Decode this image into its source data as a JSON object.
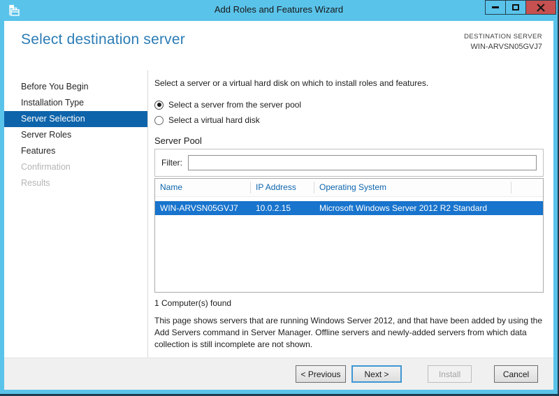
{
  "window": {
    "title": "Add Roles and Features Wizard",
    "icon": "wizard-toolbox-icon",
    "controls": [
      {
        "name": "minimize",
        "icon": "minimize-icon"
      },
      {
        "name": "maximize",
        "icon": "maximize-icon"
      },
      {
        "name": "close",
        "icon": "close-icon"
      }
    ]
  },
  "header": {
    "title": "Select destination server",
    "destination_label": "DESTINATION SERVER",
    "destination_server": "WIN-ARVSN05GVJ7"
  },
  "sidebar": {
    "items": [
      {
        "label": "Before You Begin",
        "state": "enabled"
      },
      {
        "label": "Installation Type",
        "state": "enabled"
      },
      {
        "label": "Server Selection",
        "state": "selected"
      },
      {
        "label": "Server Roles",
        "state": "enabled"
      },
      {
        "label": "Features",
        "state": "enabled"
      },
      {
        "label": "Confirmation",
        "state": "disabled"
      },
      {
        "label": "Results",
        "state": "disabled"
      }
    ]
  },
  "main": {
    "intro": "Select a server or a virtual hard disk on which to install roles and features.",
    "radio_options": [
      {
        "label": "Select a server from the server pool",
        "selected": true
      },
      {
        "label": "Select a virtual hard disk",
        "selected": false
      }
    ],
    "server_pool": {
      "section_title": "Server Pool",
      "filter_label": "Filter:",
      "filter_value": "",
      "table": {
        "columns": [
          "Name",
          "IP Address",
          "Operating System"
        ],
        "rows": [
          {
            "name": "WIN-ARVSN05GVJ7",
            "ip": "10.0.2.15",
            "os": "Microsoft Windows Server 2012 R2 Standard",
            "selected": true
          }
        ]
      },
      "count_text": "1 Computer(s) found"
    },
    "description": "This page shows servers that are running Windows Server 2012, and that have been added by using the Add Servers command in Server Manager. Offline servers and newly-added servers from which data collection is still incomplete are not shown."
  },
  "footer": {
    "buttons": [
      {
        "label": "< Previous",
        "state": "enabled"
      },
      {
        "label": "Next >",
        "state": "default"
      },
      {
        "label": "Install",
        "state": "disabled"
      },
      {
        "label": "Cancel",
        "state": "enabled"
      }
    ]
  },
  "colors": {
    "titlebar_blue": "#5ac3ea",
    "close_red": "#c75050",
    "heading_blue": "#2b7cb5",
    "sidebar_selected_blue": "#0e64ab",
    "row_selected_blue": "#1874cd",
    "table_header_blue": "#0c64ad"
  }
}
